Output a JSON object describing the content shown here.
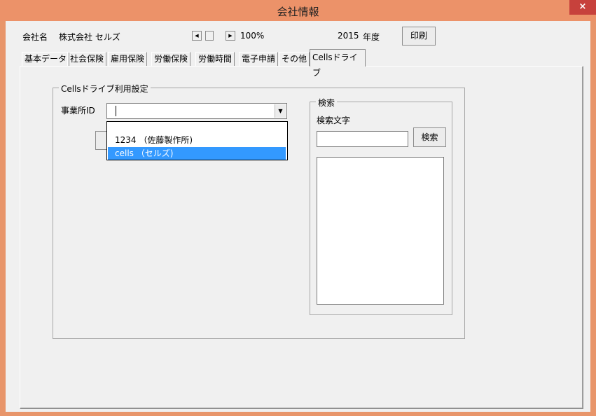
{
  "window": {
    "title": "会社情報",
    "close_label": "×"
  },
  "header": {
    "company_label": "会社名",
    "company_name": "株式会社 セルズ",
    "zoom": "100%",
    "year_value": "2015",
    "year_label": "年度",
    "print_label": "印刷"
  },
  "tabs": [
    {
      "label": "基本データ"
    },
    {
      "label": "社会保険"
    },
    {
      "label": "雇用保険"
    },
    {
      "label": "労働保険"
    },
    {
      "label": "労働時間"
    },
    {
      "label": "電子申請"
    },
    {
      "label": "その他"
    },
    {
      "label": "Cellsドライブ"
    }
  ],
  "settings_group": {
    "title": "Cellsドライブ利用設定",
    "office_id_label": "事業所ID",
    "office_id_value": "",
    "options": [
      {
        "label": "1234 （佐藤製作所)"
      },
      {
        "label": "cells （セルズ)"
      }
    ],
    "selected_index": 1
  },
  "search_group": {
    "title": "検索",
    "search_text_label": "検索文字",
    "search_text_value": "",
    "search_button_label": "検索"
  }
}
